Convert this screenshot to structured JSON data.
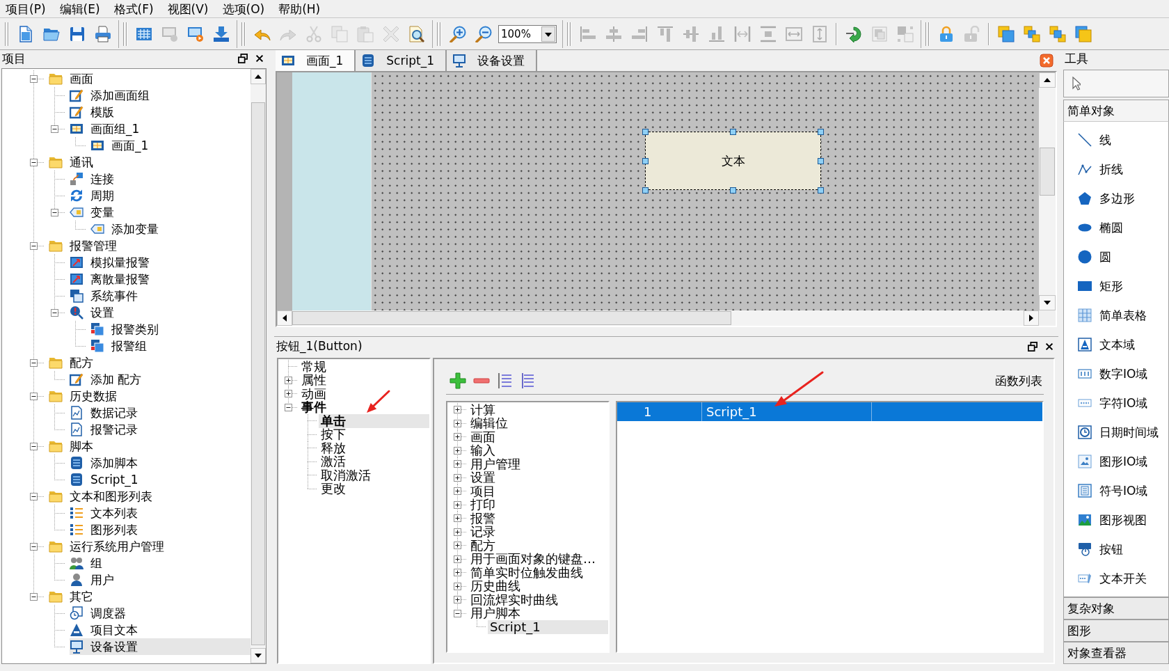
{
  "menu": [
    "项目(P)",
    "编辑(E)",
    "格式(F)",
    "视图(V)",
    "选项(O)",
    "帮助(H)"
  ],
  "toolbar": {
    "groups": [
      {
        "kind": "grip",
        "buttons": [
          {
            "disabled": false
          },
          {
            "disabled": false
          },
          {
            "disabled": false
          },
          {
            "disabled": false
          }
        ]
      },
      {
        "kind": "grip",
        "buttons": [
          {
            "disabled": false
          },
          {
            "disabled": true
          },
          {
            "disabled": false
          },
          {
            "disabled": false
          }
        ]
      },
      {
        "kind": "grip",
        "buttons": [
          {
            "disabled": false
          },
          {
            "disabled": true
          },
          {
            "disabled": true
          },
          {
            "disabled": true
          },
          {
            "disabled": true
          },
          {
            "disabled": true
          },
          {
            "disabled": false
          }
        ]
      },
      {
        "kind": "grip",
        "buttons": [
          {
            "disabled": false
          },
          {
            "disabled": false
          }
        ],
        "combo": {
          "value": "100%"
        }
      },
      {
        "kind": "grip",
        "buttons": [
          {
            "disabled": true
          },
          {
            "disabled": true
          },
          {
            "disabled": true
          },
          {
            "disabled": true
          },
          {
            "disabled": true
          },
          {
            "disabled": true
          },
          {
            "disabled": true
          },
          {
            "disabled": true
          },
          {
            "disabled": true
          },
          {
            "disabled": true
          }
        ]
      },
      {
        "kind": "separator",
        "buttons": [
          {
            "disabled": false
          },
          {
            "disabled": true
          },
          {
            "disabled": true
          }
        ]
      },
      {
        "kind": "grip",
        "buttons": [
          {
            "disabled": false
          },
          {
            "disabled": true
          }
        ]
      },
      {
        "kind": "separator",
        "buttons": [
          {
            "disabled": false
          },
          {
            "disabled": false
          },
          {
            "disabled": false
          },
          {
            "disabled": false
          }
        ]
      }
    ]
  },
  "project_panel": {
    "title": "项目",
    "tree": [
      {
        "label": "画面",
        "kind": "folder",
        "expanded": true,
        "selected": false,
        "children": [
          {
            "label": "添加画面组",
            "kind": "pencil",
            "selected": false
          },
          {
            "label": "模版",
            "kind": "pencil",
            "selected": false
          },
          {
            "label": "画面组_1",
            "kind": "screen",
            "expanded": true,
            "selected": false,
            "children": [
              {
                "label": "画面_1",
                "kind": "screen",
                "selected": false
              }
            ]
          }
        ]
      },
      {
        "label": "通讯",
        "kind": "folder",
        "expanded": true,
        "selected": false,
        "children": [
          {
            "label": "连接",
            "kind": "link",
            "selected": false
          },
          {
            "label": "周期",
            "kind": "cycle",
            "selected": false
          },
          {
            "label": "变量",
            "kind": "tag",
            "expanded": true,
            "selected": false,
            "children": [
              {
                "label": "添加变量",
                "kind": "tag",
                "selected": false
              }
            ]
          }
        ]
      },
      {
        "label": "报警管理",
        "kind": "folder",
        "expanded": true,
        "selected": false,
        "children": [
          {
            "label": "模拟量报警",
            "kind": "alarm",
            "selected": false
          },
          {
            "label": "离散量报警",
            "kind": "alarm",
            "selected": false
          },
          {
            "label": "系统事件",
            "kind": "window",
            "selected": false
          },
          {
            "label": "设置",
            "kind": "settings",
            "expanded": true,
            "selected": false,
            "children": [
              {
                "label": "报警类别",
                "kind": "messages",
                "selected": false
              },
              {
                "label": "报警组",
                "kind": "messages",
                "selected": false
              }
            ]
          }
        ]
      },
      {
        "label": "配方",
        "kind": "folder",
        "expanded": true,
        "selected": false,
        "children": [
          {
            "label": "添加 配方",
            "kind": "pencil",
            "selected": false
          }
        ]
      },
      {
        "label": "历史数据",
        "kind": "folder",
        "expanded": true,
        "selected": false,
        "children": [
          {
            "label": "数据记录",
            "kind": "document",
            "selected": false
          },
          {
            "label": "报警记录",
            "kind": "document",
            "selected": false
          }
        ]
      },
      {
        "label": "脚本",
        "kind": "folder",
        "expanded": true,
        "selected": false,
        "children": [
          {
            "label": "添加脚本",
            "kind": "script",
            "selected": false
          },
          {
            "label": "Script_1",
            "kind": "script",
            "selected": false
          }
        ]
      },
      {
        "label": "文本和图形列表",
        "kind": "folder",
        "expanded": true,
        "selected": false,
        "children": [
          {
            "label": "文本列表",
            "kind": "list",
            "selected": false
          },
          {
            "label": "图形列表",
            "kind": "list",
            "selected": false
          }
        ]
      },
      {
        "label": "运行系统用户管理",
        "kind": "folder",
        "expanded": true,
        "selected": false,
        "children": [
          {
            "label": "组",
            "kind": "users",
            "selected": false
          },
          {
            "label": "用户",
            "kind": "user",
            "selected": false
          }
        ]
      },
      {
        "label": "其它",
        "kind": "folder",
        "expanded": true,
        "selected": false,
        "children": [
          {
            "label": "调度器",
            "kind": "clock",
            "selected": false
          },
          {
            "label": "项目文本",
            "kind": "letter",
            "selected": false
          },
          {
            "label": "设备设置",
            "kind": "monitor",
            "selected": true
          }
        ]
      }
    ]
  },
  "editor": {
    "tabs": [
      {
        "label": "画面_1",
        "kind": "screen",
        "selected": true
      },
      {
        "label": "Script_1",
        "kind": "script",
        "selected": false
      },
      {
        "label": "设备设置",
        "kind": "monitor",
        "selected": false
      }
    ],
    "canvas": {
      "objects": [
        {
          "text": "文本",
          "selected": true
        }
      ]
    }
  },
  "properties_panel": {
    "title": "按钮_1(Button)",
    "event_tree": [
      {
        "label": "常规",
        "selected": false,
        "configured": false
      },
      {
        "label": "属性",
        "expanded": false,
        "selected": false,
        "configured": false
      },
      {
        "label": "动画",
        "expanded": false,
        "selected": false,
        "configured": false
      },
      {
        "label": "事件",
        "expanded": true,
        "selected": false,
        "configured": true,
        "children": [
          {
            "label": "单击",
            "selected": true,
            "configured": true
          },
          {
            "label": "按下",
            "selected": false,
            "configured": false
          },
          {
            "label": "释放",
            "selected": false,
            "configured": false
          },
          {
            "label": "激活",
            "selected": false,
            "configured": false
          },
          {
            "label": "取消激活",
            "selected": false,
            "configured": false
          },
          {
            "label": "更改",
            "selected": false,
            "configured": false
          }
        ]
      }
    ],
    "function_tree": [
      {
        "label": "计算",
        "expanded": false,
        "selected": false
      },
      {
        "label": "编辑位",
        "expanded": false,
        "selected": false
      },
      {
        "label": "画面",
        "expanded": false,
        "selected": false
      },
      {
        "label": "输入",
        "expanded": false,
        "selected": false
      },
      {
        "label": "用户管理",
        "expanded": false,
        "selected": false
      },
      {
        "label": "设置",
        "expanded": false,
        "selected": false
      },
      {
        "label": "项目",
        "expanded": false,
        "selected": false
      },
      {
        "label": "打印",
        "expanded": false,
        "selected": false
      },
      {
        "label": "报警",
        "expanded": false,
        "selected": false
      },
      {
        "label": "记录",
        "expanded": false,
        "selected": false
      },
      {
        "label": "配方",
        "expanded": false,
        "selected": false
      },
      {
        "label": "用于画面对象的键盘…",
        "expanded": false,
        "selected": false
      },
      {
        "label": "简单实时位触发曲线",
        "expanded": false,
        "selected": false
      },
      {
        "label": "历史曲线",
        "expanded": false,
        "selected": false
      },
      {
        "label": "回流焊实时曲线",
        "expanded": false,
        "selected": false
      },
      {
        "label": "用户脚本",
        "expanded": true,
        "selected": false,
        "children": [
          {
            "label": "Script_1",
            "selected": true
          }
        ]
      }
    ],
    "function_list": {
      "title": "函数列表",
      "rows": [
        {
          "cells": [
            "1",
            "Script_1"
          ],
          "selected": true
        }
      ]
    }
  },
  "tools_panel": {
    "title": "工具",
    "sections": [
      {
        "title": "简单对象",
        "expanded": true,
        "items": [
          {
            "label": "线",
            "kind": "line"
          },
          {
            "label": "折线",
            "kind": "polyline"
          },
          {
            "label": "多边形",
            "kind": "polygon"
          },
          {
            "label": "椭圆",
            "kind": "ellipse"
          },
          {
            "label": "圆",
            "kind": "circle"
          },
          {
            "label": "矩形",
            "kind": "rectangle"
          },
          {
            "label": "简单表格",
            "kind": "table"
          },
          {
            "label": "文本域",
            "kind": "textfield"
          },
          {
            "label": "数字IO域",
            "kind": "number"
          },
          {
            "label": "字符IO域",
            "kind": "chars"
          },
          {
            "label": "日期时间域",
            "kind": "datetime"
          },
          {
            "label": "图形IO域",
            "kind": "graphic"
          },
          {
            "label": "符号IO域",
            "kind": "symbol"
          },
          {
            "label": "图形视图",
            "kind": "picture"
          },
          {
            "label": "按钮",
            "kind": "button"
          },
          {
            "label": "文本开关",
            "kind": "switch"
          }
        ]
      },
      {
        "title": "复杂对象",
        "expanded": false
      },
      {
        "title": "图形",
        "expanded": false
      },
      {
        "title": "对象查看器",
        "expanded": false
      }
    ]
  }
}
